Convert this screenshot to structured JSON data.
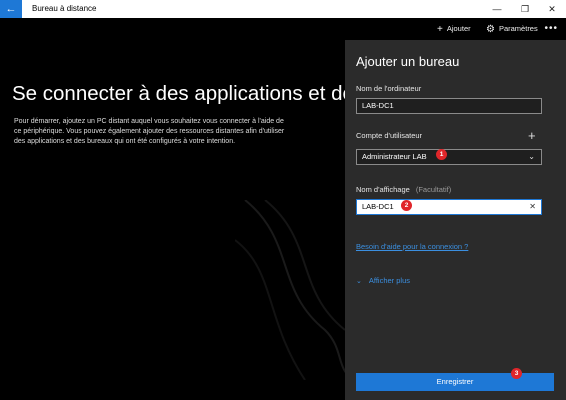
{
  "window": {
    "back_icon": "←",
    "title": "Bureau à distance",
    "minimize_icon": "—",
    "maximize_icon": "❐",
    "close_icon": "✕"
  },
  "commandbar": {
    "add_icon": "+",
    "add_label": "Ajouter",
    "settings_icon": "⚙",
    "settings_label": "Paramètres",
    "more_icon": "•••"
  },
  "main": {
    "heading": "Se connecter à des applications et des bureaux",
    "description": "Pour démarrer, ajoutez un PC distant auquel vous souhaitez vous connecter à l'aide de ce périphérique. Vous pouvez également ajouter des ressources distantes afin d'utiliser des applications et des bureaux qui ont été configurés à votre intention."
  },
  "panel": {
    "title": "Ajouter un bureau",
    "computer_name_label": "Nom de l'ordinateur",
    "computer_name_value": "LAB-DC1",
    "user_account_label": "Compte d'utilisateur",
    "add_user_icon": "+",
    "user_account_value": "Administrateur LAB",
    "dropdown_icon": "⌄",
    "display_name_label": "Nom d'affichage",
    "display_name_optional": "(Facultatif)",
    "display_name_value": "LAB-DC1",
    "clear_icon": "✕",
    "help_link": "Besoin d'aide pour la connexion ?",
    "show_more_icon": "⌄",
    "show_more_label": "Afficher plus",
    "save_label": "Enregistrer"
  },
  "annotations": {
    "badge1": "1",
    "badge2": "2",
    "badge3": "3"
  },
  "colors": {
    "accent": "#1e78d6",
    "panel_bg": "#2b2b2b",
    "badge": "#e0262a"
  }
}
